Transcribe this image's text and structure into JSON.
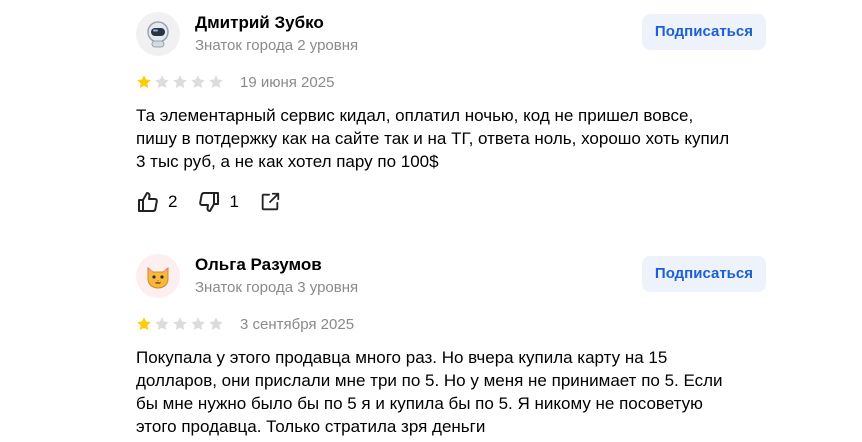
{
  "reviews": [
    {
      "author": "Дмитрий Зубко",
      "badge": "Знаток города 2 уровня",
      "avatar_icon": "astronaut-icon",
      "subscribe_label": "Подписаться",
      "rating": 1,
      "rating_max": 5,
      "date": "19 июня 2025",
      "text": "Та элементарный сервис кидал, оплатил ночью, код не пришел вовсе,\nпишу в потдержку как на сайте так и на ТГ, ответа ноль, хорошо хоть купил\n3 тыс руб, а не как хотел пару по 100$",
      "likes": "2",
      "dislikes": "1",
      "icons": {
        "like": "thumbs-up-icon",
        "dislike": "thumbs-down-icon",
        "share": "share-icon"
      }
    },
    {
      "author": "Ольга Разумов",
      "badge": "Знаток города 3 уровня",
      "avatar_icon": "cat-face-icon",
      "subscribe_label": "Подписаться",
      "rating": 1,
      "rating_max": 5,
      "date": "3 сентября 2025",
      "text": "Покупала у этого продавца много раз. Но вчера купила карту на 15\nдолларов, они прислали мне три по 5. Но у меня не принимает по 5. Если\nбы мне нужно было бы по 5 я и купила бы по 5. Я никому не посоветую\nэтого продавца. Только стратила зря деньги"
    }
  ],
  "colors": {
    "star_filled": "#fc0",
    "star_empty": "#dcdcdc",
    "subscribe_bg": "#eef2fb",
    "subscribe_text": "#1d5fd6",
    "muted_text": "#8a8a8a"
  }
}
